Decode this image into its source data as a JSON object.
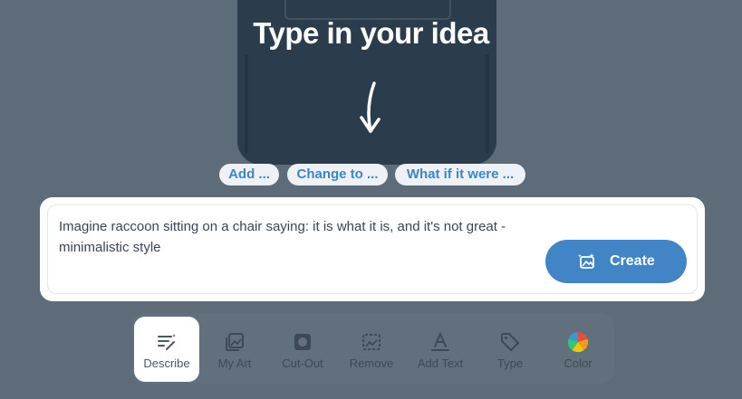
{
  "hero": {
    "title": "Type in your idea"
  },
  "suggestions": [
    {
      "label": "Add ..."
    },
    {
      "label": "Change to ..."
    },
    {
      "label": "What if it were ..."
    }
  ],
  "prompt": {
    "text": "Imagine raccoon sitting on a chair saying: it is what it is, and it's not great - minimalistic style"
  },
  "create_button": {
    "label": "Create",
    "icon": "magic-image-icon"
  },
  "toolbar": {
    "tools": [
      {
        "label": "Describe",
        "icon": "describe-icon",
        "active": true
      },
      {
        "label": "My Art",
        "icon": "my-art-icon"
      },
      {
        "label": "Cut-Out",
        "icon": "cut-out-icon"
      },
      {
        "label": "Remove",
        "icon": "remove-icon"
      },
      {
        "label": "Add Text",
        "icon": "add-text-icon"
      },
      {
        "label": "Type",
        "icon": "tag-icon"
      },
      {
        "label": "Color",
        "icon": "color-wheel-icon"
      }
    ]
  },
  "colors": {
    "accent": "#4285c7",
    "background": "#5e6b78",
    "shirt": "#2b3d4c",
    "chip_text": "#3d86c6"
  }
}
